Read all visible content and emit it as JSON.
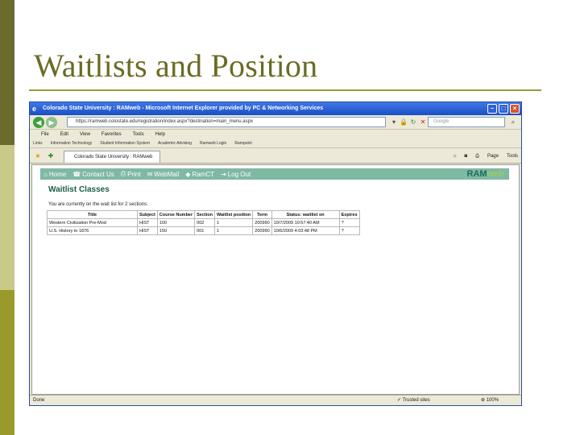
{
  "slide": {
    "title": "Waitlists and Position"
  },
  "browser": {
    "window_title": "Colorado State University : RAMweb - Microsoft Internet Explorer provided by PC & Networking Services",
    "url": "https://ramweb.colostate.edu/registration/index.aspx?destination=main_menu.aspx",
    "search_placeholder": "Google",
    "menu": [
      "File",
      "Edit",
      "View",
      "Favorites",
      "Tools",
      "Help"
    ],
    "links": [
      "Links",
      "Information Technology",
      "Student Information System",
      "Academic Advising",
      "Ramweb Login",
      "Rampoint"
    ],
    "tab_label": "Colorado State University : RAMweb",
    "tab_tools": [
      "Page",
      "Tools"
    ],
    "status": {
      "text": "Done",
      "zone": "Trusted sites",
      "zoom": "100%"
    }
  },
  "page": {
    "nav": [
      {
        "label": "Home",
        "icon": "home-icon"
      },
      {
        "label": "Contact Us",
        "icon": "contact-icon"
      },
      {
        "label": "Print",
        "icon": "print-icon"
      },
      {
        "label": "WebMail",
        "icon": "mail-icon"
      },
      {
        "label": "RamCT",
        "icon": "ramct-icon"
      },
      {
        "label": "Log Out",
        "icon": "logout-icon"
      }
    ],
    "logo_main": "RAM",
    "logo_accent": "web",
    "heading": "Waitlist Classes",
    "subtitle": "You are currently on the wait list for 2 sections:",
    "table": {
      "headers": [
        "Title",
        "Subject",
        "Course Number",
        "Section",
        "Waitlist position",
        "Term",
        "Status: waitlist on",
        "Expires"
      ],
      "rows": [
        [
          "Western Civilization Pre-Mod",
          "HIST",
          "100",
          "002",
          "1",
          "200990",
          "10/7/2009 10:57:40 AM",
          "?"
        ],
        [
          "U.S. History to 1876",
          "HIST",
          "150",
          "001",
          "1",
          "200990",
          "10/6/2009 4:03:48 PM",
          "?"
        ]
      ]
    }
  },
  "colors": {
    "slide_title": "#6b6b24",
    "nav_bar": "#7fb8a3",
    "heading": "#1a5d47",
    "titlebar": "#1a4fc4"
  }
}
